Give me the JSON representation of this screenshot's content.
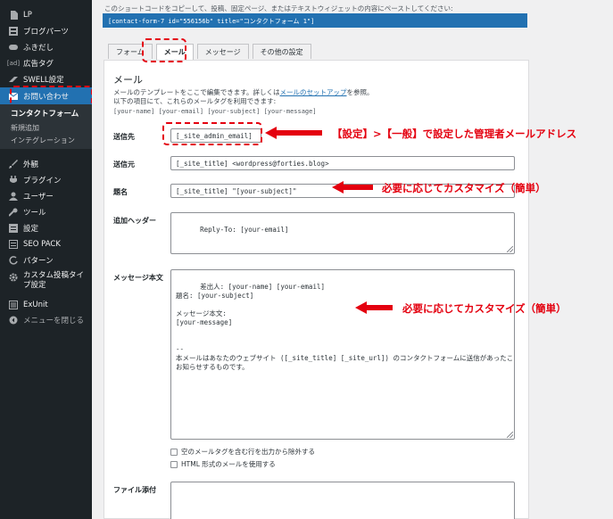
{
  "sidebar": {
    "items": [
      {
        "label": "LP",
        "icon": "page-icon"
      },
      {
        "label": "ブログパーツ",
        "icon": "blog-parts-icon"
      },
      {
        "label": "ふきだし",
        "icon": "speech-bubble-icon"
      },
      {
        "label": "広告タグ",
        "icon": "ad-tag-icon"
      },
      {
        "label": "SWELL設定",
        "icon": "swell-icon"
      },
      {
        "label": "お問い合わせ",
        "icon": "mail-icon"
      }
    ],
    "submenu": [
      "コンタクトフォーム",
      "新規追加",
      "インテグレーション"
    ],
    "bottom_items": [
      {
        "label": "外観",
        "icon": "brush-icon"
      },
      {
        "label": "プラグイン",
        "icon": "plugin-icon"
      },
      {
        "label": "ユーザー",
        "icon": "user-icon"
      },
      {
        "label": "ツール",
        "icon": "wrench-icon"
      },
      {
        "label": "設定",
        "icon": "settings-icon"
      },
      {
        "label": "SEO PACK",
        "icon": "seo-icon"
      },
      {
        "label": "パターン",
        "icon": "pattern-icon"
      },
      {
        "label": "カスタム投稿タイプ設定",
        "icon": "gear-icon"
      },
      {
        "label": "ExUnit",
        "icon": "exunit-icon"
      },
      {
        "label": "メニューを閉じる",
        "icon": "collapse-icon"
      }
    ]
  },
  "header": {
    "note": "このショートコードをコピーして、投稿、固定ページ、またはテキストウィジェットの内容にペーストしてください:",
    "shortcode": "[contact-form-7 id=\"556156b\" title=\"コンタクトフォーム 1\"]"
  },
  "tabs": [
    "フォーム",
    "メール",
    "メッセージ",
    "その他の設定"
  ],
  "panel": {
    "title": "メール",
    "desc_1a": "メールのテンプレートをここで編集できます。詳しくは",
    "desc_link": "メールのセットアップ",
    "desc_1b": "を参照。",
    "desc_2": "以下の項目にて、これらのメールタグを利用できます:",
    "tags": "[your-name] [your-email] [your-subject] [your-message]"
  },
  "fields": {
    "to": {
      "label": "送信先",
      "value": "[_site_admin_email]"
    },
    "from": {
      "label": "送信元",
      "value": "[_site_title] <wordpress@forties.blog>"
    },
    "subject": {
      "label": "題名",
      "value": "[_site_title] \"[your-subject]\""
    },
    "headers": {
      "label": "追加ヘッダー",
      "value": "Reply-To: [your-email]"
    },
    "body": {
      "label": "メッセージ本文",
      "value": "差出人: [your-name] [your-email]\n題名: [your-subject]\n\nメッセージ本文:\n[your-message]\n\n\n--\n本メールはあなたのウェブサイト ([_site_title] [_site_url]) のコンタクトフォームに送信があったことを\nお知らせするものです。"
    },
    "exclude_blank": "空のメールタグを含む行を出力から除外する",
    "use_html": "HTML 形式のメールを使用する",
    "attachments": {
      "label": "ファイル添付",
      "value": ""
    }
  },
  "annotations": {
    "to_note": "【設定】>【一般】で設定した管理者メールアドレス",
    "subject_note": "必要に応じてカスタマイズ（簡単）",
    "body_note": "必要に応じてカスタマイズ（簡単）"
  },
  "colors": {
    "sidebar_bg": "#1d2327",
    "accent": "#2271b1",
    "annotation_red": "#e4000f"
  }
}
